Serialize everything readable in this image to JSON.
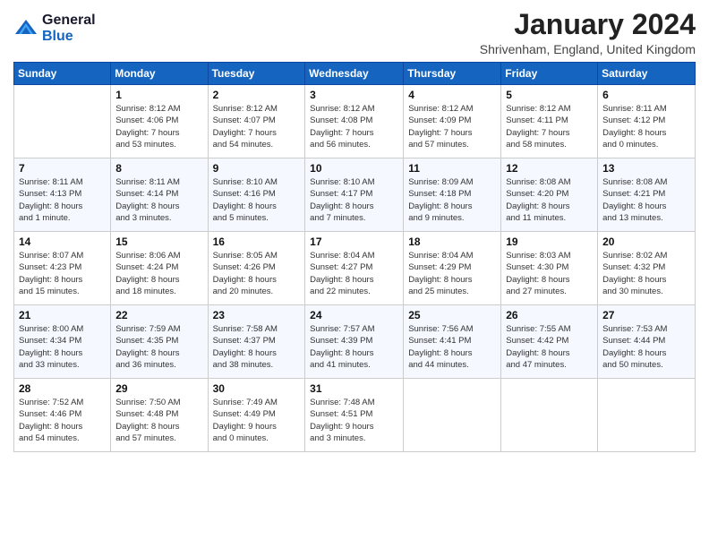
{
  "header": {
    "logo_line1": "General",
    "logo_line2": "Blue",
    "month_title": "January 2024",
    "location": "Shrivenham, England, United Kingdom"
  },
  "days_of_week": [
    "Sunday",
    "Monday",
    "Tuesday",
    "Wednesday",
    "Thursday",
    "Friday",
    "Saturday"
  ],
  "weeks": [
    [
      {
        "num": "",
        "info": ""
      },
      {
        "num": "1",
        "info": "Sunrise: 8:12 AM\nSunset: 4:06 PM\nDaylight: 7 hours\nand 53 minutes."
      },
      {
        "num": "2",
        "info": "Sunrise: 8:12 AM\nSunset: 4:07 PM\nDaylight: 7 hours\nand 54 minutes."
      },
      {
        "num": "3",
        "info": "Sunrise: 8:12 AM\nSunset: 4:08 PM\nDaylight: 7 hours\nand 56 minutes."
      },
      {
        "num": "4",
        "info": "Sunrise: 8:12 AM\nSunset: 4:09 PM\nDaylight: 7 hours\nand 57 minutes."
      },
      {
        "num": "5",
        "info": "Sunrise: 8:12 AM\nSunset: 4:11 PM\nDaylight: 7 hours\nand 58 minutes."
      },
      {
        "num": "6",
        "info": "Sunrise: 8:11 AM\nSunset: 4:12 PM\nDaylight: 8 hours\nand 0 minutes."
      }
    ],
    [
      {
        "num": "7",
        "info": "Sunrise: 8:11 AM\nSunset: 4:13 PM\nDaylight: 8 hours\nand 1 minute."
      },
      {
        "num": "8",
        "info": "Sunrise: 8:11 AM\nSunset: 4:14 PM\nDaylight: 8 hours\nand 3 minutes."
      },
      {
        "num": "9",
        "info": "Sunrise: 8:10 AM\nSunset: 4:16 PM\nDaylight: 8 hours\nand 5 minutes."
      },
      {
        "num": "10",
        "info": "Sunrise: 8:10 AM\nSunset: 4:17 PM\nDaylight: 8 hours\nand 7 minutes."
      },
      {
        "num": "11",
        "info": "Sunrise: 8:09 AM\nSunset: 4:18 PM\nDaylight: 8 hours\nand 9 minutes."
      },
      {
        "num": "12",
        "info": "Sunrise: 8:08 AM\nSunset: 4:20 PM\nDaylight: 8 hours\nand 11 minutes."
      },
      {
        "num": "13",
        "info": "Sunrise: 8:08 AM\nSunset: 4:21 PM\nDaylight: 8 hours\nand 13 minutes."
      }
    ],
    [
      {
        "num": "14",
        "info": "Sunrise: 8:07 AM\nSunset: 4:23 PM\nDaylight: 8 hours\nand 15 minutes."
      },
      {
        "num": "15",
        "info": "Sunrise: 8:06 AM\nSunset: 4:24 PM\nDaylight: 8 hours\nand 18 minutes."
      },
      {
        "num": "16",
        "info": "Sunrise: 8:05 AM\nSunset: 4:26 PM\nDaylight: 8 hours\nand 20 minutes."
      },
      {
        "num": "17",
        "info": "Sunrise: 8:04 AM\nSunset: 4:27 PM\nDaylight: 8 hours\nand 22 minutes."
      },
      {
        "num": "18",
        "info": "Sunrise: 8:04 AM\nSunset: 4:29 PM\nDaylight: 8 hours\nand 25 minutes."
      },
      {
        "num": "19",
        "info": "Sunrise: 8:03 AM\nSunset: 4:30 PM\nDaylight: 8 hours\nand 27 minutes."
      },
      {
        "num": "20",
        "info": "Sunrise: 8:02 AM\nSunset: 4:32 PM\nDaylight: 8 hours\nand 30 minutes."
      }
    ],
    [
      {
        "num": "21",
        "info": "Sunrise: 8:00 AM\nSunset: 4:34 PM\nDaylight: 8 hours\nand 33 minutes."
      },
      {
        "num": "22",
        "info": "Sunrise: 7:59 AM\nSunset: 4:35 PM\nDaylight: 8 hours\nand 36 minutes."
      },
      {
        "num": "23",
        "info": "Sunrise: 7:58 AM\nSunset: 4:37 PM\nDaylight: 8 hours\nand 38 minutes."
      },
      {
        "num": "24",
        "info": "Sunrise: 7:57 AM\nSunset: 4:39 PM\nDaylight: 8 hours\nand 41 minutes."
      },
      {
        "num": "25",
        "info": "Sunrise: 7:56 AM\nSunset: 4:41 PM\nDaylight: 8 hours\nand 44 minutes."
      },
      {
        "num": "26",
        "info": "Sunrise: 7:55 AM\nSunset: 4:42 PM\nDaylight: 8 hours\nand 47 minutes."
      },
      {
        "num": "27",
        "info": "Sunrise: 7:53 AM\nSunset: 4:44 PM\nDaylight: 8 hours\nand 50 minutes."
      }
    ],
    [
      {
        "num": "28",
        "info": "Sunrise: 7:52 AM\nSunset: 4:46 PM\nDaylight: 8 hours\nand 54 minutes."
      },
      {
        "num": "29",
        "info": "Sunrise: 7:50 AM\nSunset: 4:48 PM\nDaylight: 8 hours\nand 57 minutes."
      },
      {
        "num": "30",
        "info": "Sunrise: 7:49 AM\nSunset: 4:49 PM\nDaylight: 9 hours\nand 0 minutes."
      },
      {
        "num": "31",
        "info": "Sunrise: 7:48 AM\nSunset: 4:51 PM\nDaylight: 9 hours\nand 3 minutes."
      },
      {
        "num": "",
        "info": ""
      },
      {
        "num": "",
        "info": ""
      },
      {
        "num": "",
        "info": ""
      }
    ]
  ]
}
